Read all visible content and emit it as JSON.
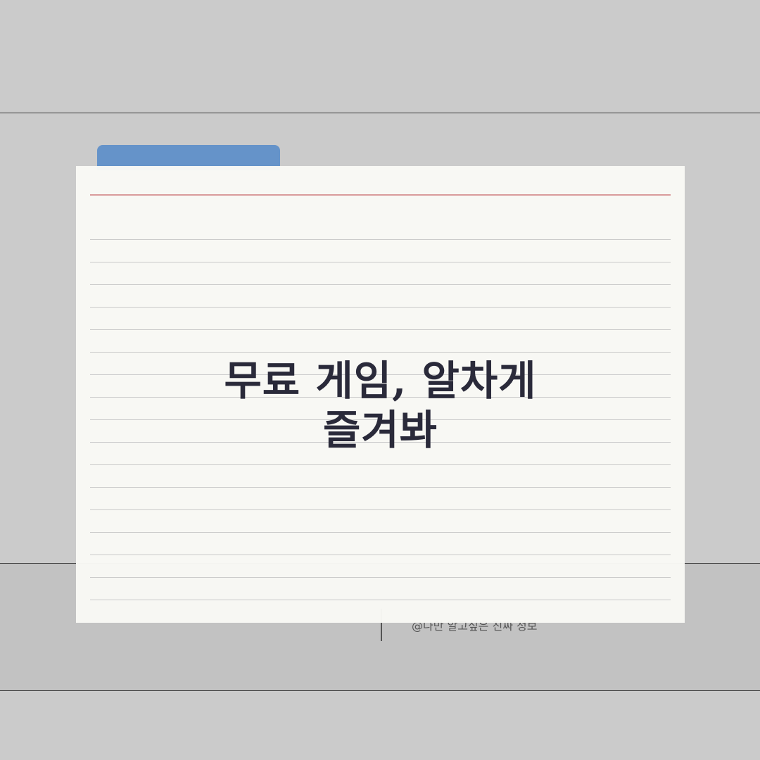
{
  "card": {
    "title_line1": "무료 게임, 알차게",
    "title_line2": "즐겨봐"
  },
  "footer": {
    "credit": "@나만 알고싶은 진짜 정보"
  },
  "colors": {
    "background": "#cbcbcb",
    "tab": "#6593c9",
    "card": "#f9f9f5",
    "margin_rule": "#d99b9b",
    "title_text": "#2a2a3a"
  }
}
